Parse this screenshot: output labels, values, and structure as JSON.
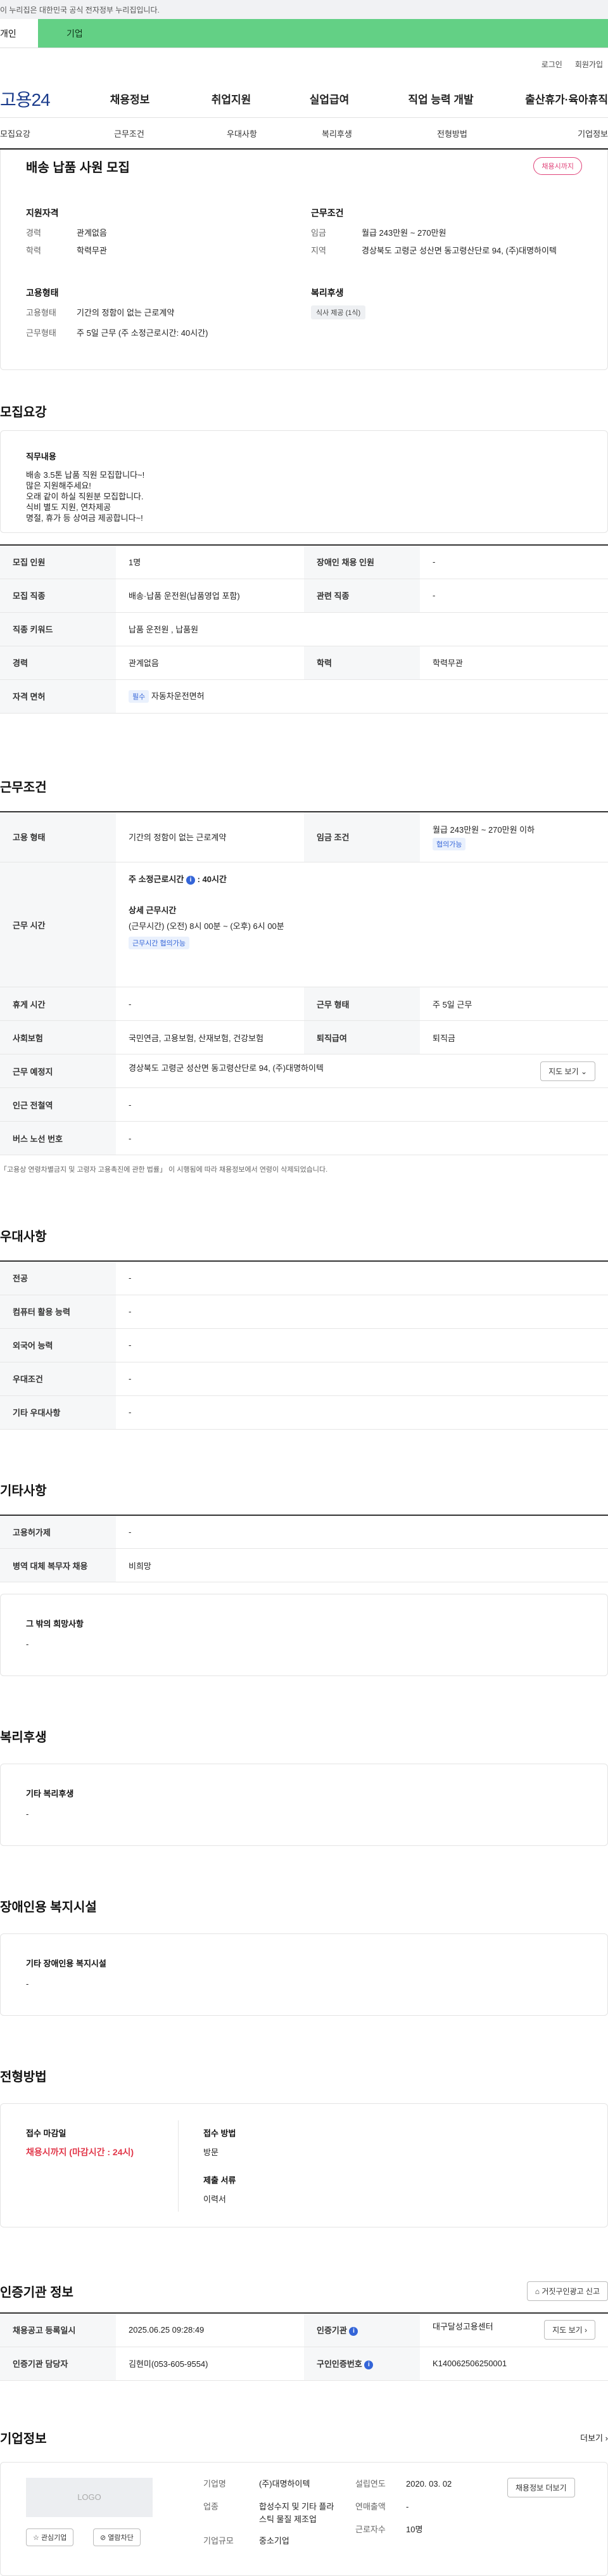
{
  "gov_banner": "이 누리집은 대한민국 공식 전자정부 누리집입니다.",
  "top_tabs": {
    "personal": "개인",
    "company": "기업"
  },
  "util": {
    "login": "로그인",
    "join": "회원가입"
  },
  "logo": "고용24",
  "gnb": [
    "채용정보",
    "취업지원",
    "실업급여",
    "직업 능력 개발",
    "출산휴가·육아휴직"
  ],
  "snb": [
    "모집요강",
    "근무조건",
    "우대사항",
    "복리후생",
    "전형방법",
    "기업정보"
  ],
  "summary": {
    "title": "배송 납품 사원 모집",
    "badge": "채용시까지",
    "qual_title": "지원자격",
    "qual": [
      {
        "k": "경력",
        "v": "관계없음"
      },
      {
        "k": "학력",
        "v": "학력무관"
      }
    ],
    "cond_title": "근무조건",
    "cond": [
      {
        "k": "임금",
        "v": "월급 243만원 ~ 270만원"
      },
      {
        "k": "지역",
        "v": "경상북도 고령군 성산면 동고령산단로 94, (주)대명하이텍"
      }
    ],
    "emp_title": "고용형태",
    "emp": [
      {
        "k": "고용형태",
        "v": "기간의 정함이 없는 근로계약"
      },
      {
        "k": "근무형태",
        "v": "주 5일 근무 (주 소정근로시간: 40시간)"
      }
    ],
    "welfare_title": "복리후생",
    "welfare_chip": "식사 제공 (1식)"
  },
  "recruit": {
    "heading": "모집요강",
    "duty_title": "직무내용",
    "duty_lines": [
      "배송 3.5톤 납품 직원 모집합니다~!",
      "많은 지원해주세요!",
      "오래 같이 하실 직원분 모집합니다.",
      "식비 별도 지원, 연차제공",
      "명절, 휴가 등 상여금 제공합니다~!"
    ],
    "rows": [
      [
        {
          "k": "모집 인원",
          "v": "1명"
        },
        {
          "k": "장애인 채용 인원",
          "v": "-"
        }
      ],
      [
        {
          "k": "모집 직종",
          "v": "배송·납품 운전원(납품영업 포함)"
        },
        {
          "k": "관련 직종",
          "v": "-"
        }
      ],
      [
        {
          "k": "직종 키워드",
          "v": "납품 운전원 , 납품원"
        }
      ],
      [
        {
          "k": "경력",
          "v": "관계없음"
        },
        {
          "k": "학력",
          "v": "학력무관"
        }
      ]
    ],
    "license_k": "자격 면허",
    "license_tag": "필수",
    "license_v": "자동차운전면허"
  },
  "work": {
    "heading": "근무조건",
    "emp_k": "고용 형태",
    "emp_v": "기간의 정함이 없는 근로계약",
    "wage_k": "임금 조건",
    "wage_v": "월급 243만원 ~ 270만원 이하",
    "wage_tag": "협의가능",
    "time_k": "근무 시간",
    "time_weekly": "주 소정근로시간",
    "time_weekly_v": ": 40시간",
    "time_detail_title": "상세 근무시간",
    "time_detail": "(근무시간) (오전) 8시 00분 ~ (오후) 6시 00분",
    "time_tag": "근무시간 협의가능",
    "rows": [
      [
        {
          "k": "휴게 시간",
          "v": "-"
        },
        {
          "k": "근무 형태",
          "v": "주 5일 근무"
        }
      ],
      [
        {
          "k": "사회보험",
          "v": "국민연금, 고용보험, 산재보험, 건강보험"
        },
        {
          "k": "퇴직급여",
          "v": "퇴직금"
        }
      ]
    ],
    "place_k": "근무 예정지",
    "place_v": "경상북도 고령군 성산면 동고령산단로 94, (주)대명하이텍",
    "map_btn": "지도 보기",
    "rows2": [
      {
        "k": "인근 전철역",
        "v": "-"
      },
      {
        "k": "버스 노선 번호",
        "v": "-"
      }
    ],
    "note": "「고용상 연령차별금지 및 고령자 고용촉진에 관한 법률」 이 시행됨에 따라 채용정보에서 연령이 삭제되었습니다."
  },
  "pref": {
    "heading": "우대사항",
    "rows": [
      {
        "k": "전공",
        "v": "-"
      },
      {
        "k": "컴퓨터 활용 능력",
        "v": "-"
      },
      {
        "k": "외국어 능력",
        "v": "-"
      },
      {
        "k": "우대조건",
        "v": "-"
      },
      {
        "k": "기타 우대사항",
        "v": "-"
      }
    ]
  },
  "etc": {
    "heading": "기타사항",
    "rows": [
      {
        "k": "고용허가제",
        "v": "-"
      },
      {
        "k": "병역 대체 복무자 채용",
        "v": "비희망"
      }
    ],
    "other_title": "그 밖의 희망사항",
    "other_v": "-"
  },
  "welfare": {
    "heading": "복리후생",
    "title": "기타 복리후생",
    "v": "-"
  },
  "disabled": {
    "heading": "장애인용 복지시설",
    "title": "기타 장애인용 복지시설",
    "v": "-"
  },
  "selection": {
    "heading": "전형방법",
    "deadline_title": "접수 마감일",
    "deadline_v": "채용시까지 (마감시간 : 24시)",
    "method_title": "접수 방법",
    "method_v": "방문",
    "docs_title": "제출 서류",
    "docs_v": "이력서"
  },
  "agency": {
    "heading": "인증기관 정보",
    "report_btn": "거짓구인광고 신고",
    "rows": [
      [
        {
          "k": "채용공고 등록일시",
          "v": "2025.06.25 09:28:49"
        },
        {
          "k": "인증기관",
          "v": "대구달성고용센터"
        }
      ],
      [
        {
          "k": "인증기관 담당자",
          "v": "김현미(053-605-9554)"
        },
        {
          "k": "구인인증번호",
          "v": "K140062506250001"
        }
      ]
    ],
    "map_btn": "지도 보기"
  },
  "company": {
    "heading": "기업정보",
    "more": "더보기",
    "logo_text": "LOGO",
    "interest_btn": "관심기업",
    "block_btn": "열람차단",
    "info": [
      {
        "k": "기업명",
        "v": "(주)대명하이텍"
      },
      {
        "k": "업종",
        "v": "합성수지 및 기타 플라스틱 물질 제조업"
      },
      {
        "k": "기업규모",
        "v": "중소기업"
      }
    ],
    "info2": [
      {
        "k": "설립연도",
        "v": "2020. 03. 02"
      },
      {
        "k": "연매출액",
        "v": "-"
      },
      {
        "k": "근로자수",
        "v": "10명"
      }
    ],
    "recruit_btn": "채용정보 더보기"
  }
}
